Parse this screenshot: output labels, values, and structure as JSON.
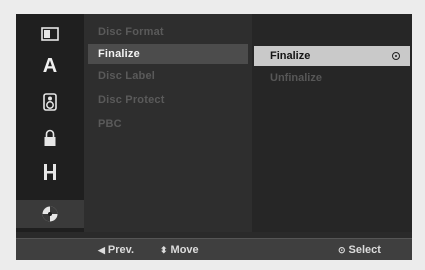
{
  "sidebar": {
    "icons": [
      {
        "name": "disc-image-icon"
      },
      {
        "name": "language-icon",
        "glyph": "A"
      },
      {
        "name": "speaker-icon"
      },
      {
        "name": "lock-icon"
      },
      {
        "name": "film-icon"
      },
      {
        "name": "disc-icon"
      }
    ],
    "active_index": 5
  },
  "menu": {
    "items": [
      {
        "label": "Disc Format"
      },
      {
        "label": "Finalize"
      },
      {
        "label": "Disc Label"
      },
      {
        "label": "Disc Protect"
      },
      {
        "label": "PBC"
      }
    ],
    "selected_index": 1
  },
  "submenu": {
    "items": [
      {
        "label": "Finalize"
      },
      {
        "label": "Unfinalize"
      }
    ],
    "selected_index": 0
  },
  "statusbar": {
    "prev": {
      "glyph": "◀",
      "label": "Prev."
    },
    "move": {
      "glyph": "⬍",
      "label": "Move"
    },
    "select": {
      "glyph": "⊙",
      "label": "Select"
    }
  },
  "colors": {
    "menu_highlight": "#4c4c4c",
    "submenu_highlight": "#c9c9c9",
    "inactive_text": "#5a5a5a"
  }
}
